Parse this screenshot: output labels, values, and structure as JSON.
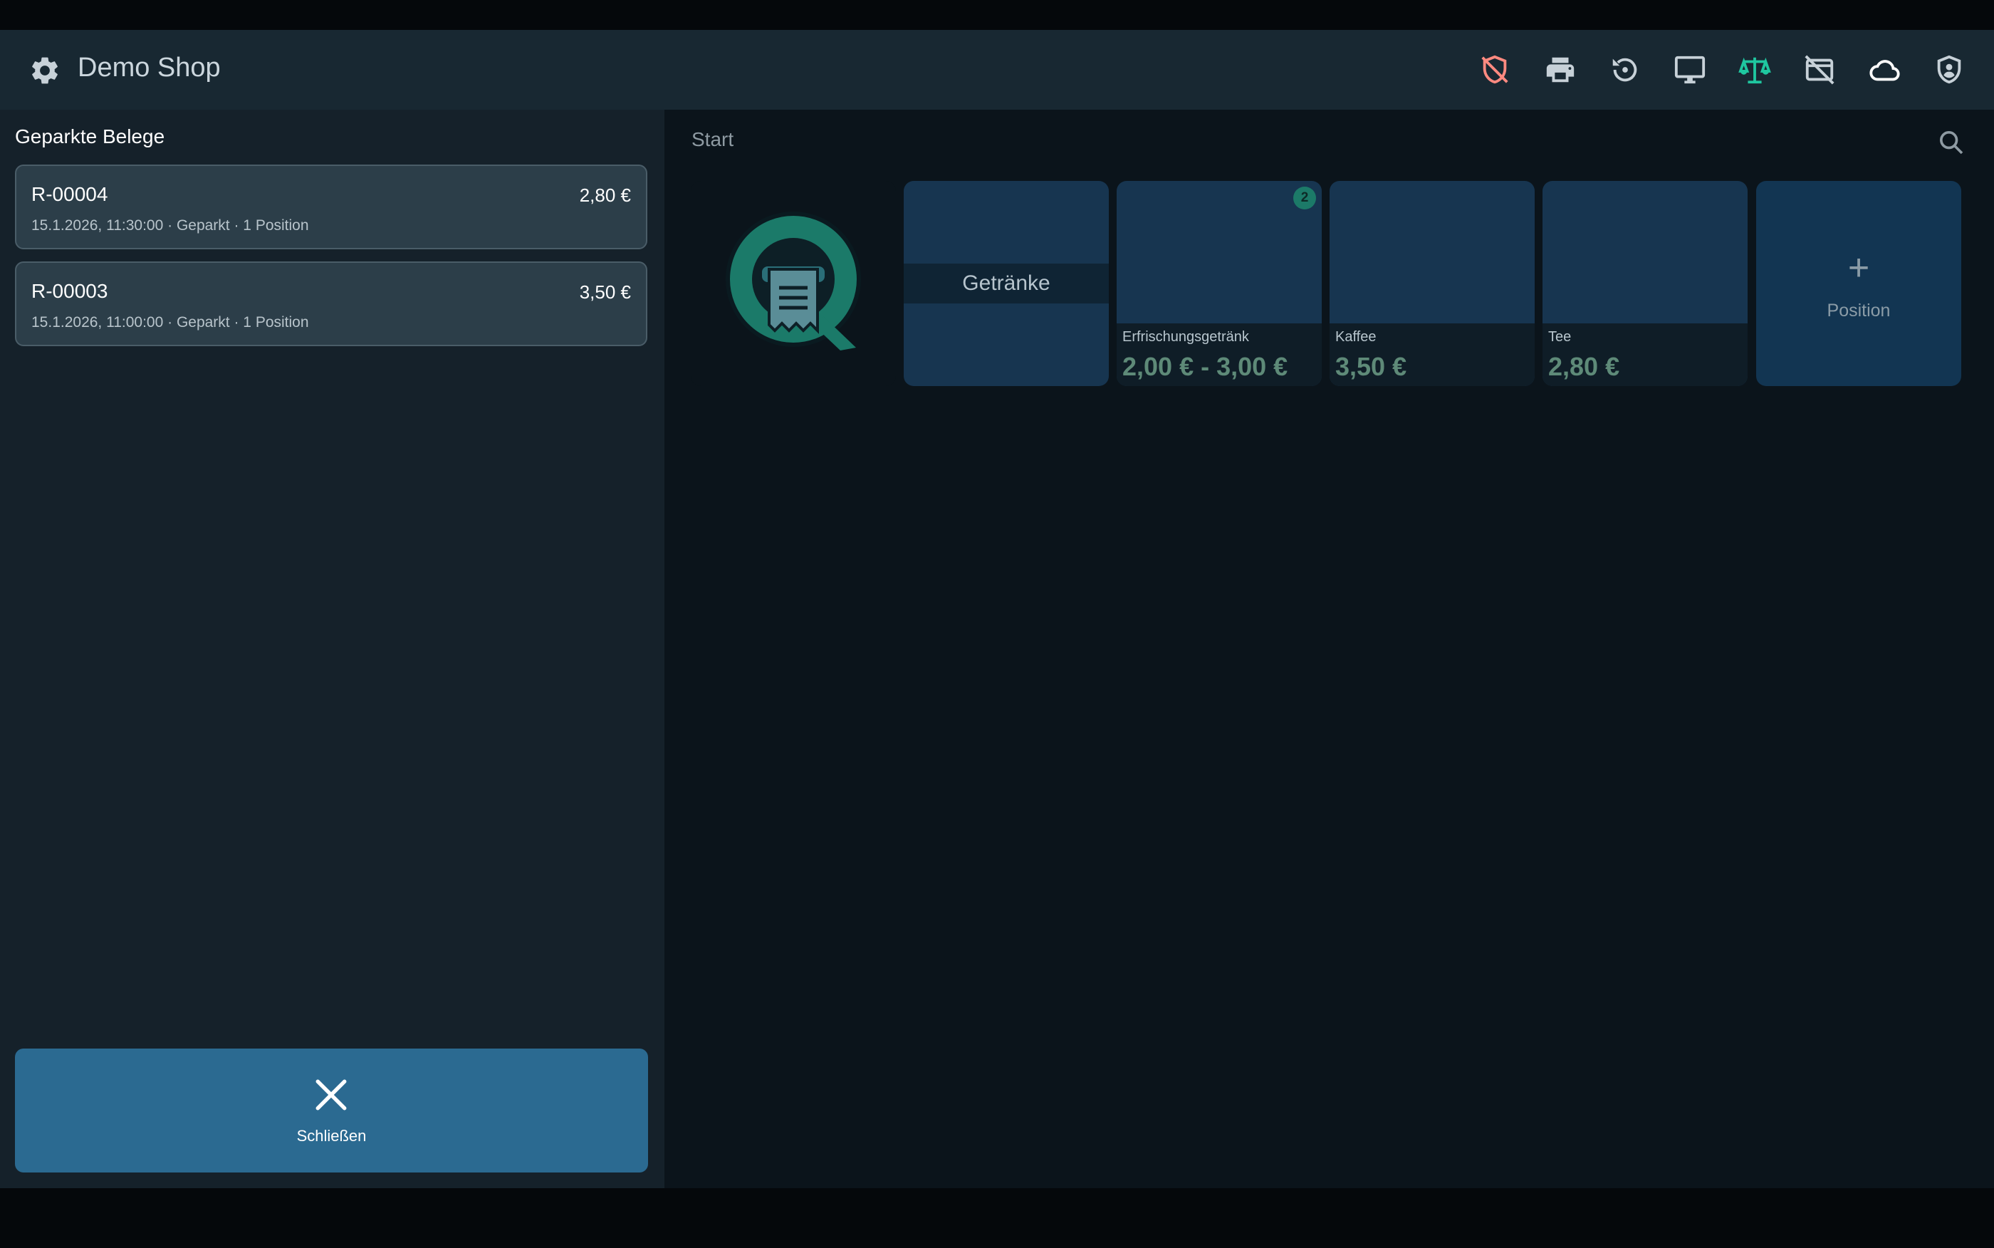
{
  "header": {
    "title": "Demo Shop",
    "icons": [
      "settings-icon",
      "shield-off-icon",
      "printer-icon",
      "history-icon",
      "monitor-icon",
      "scale-icon",
      "card-off-icon",
      "cloud-icon",
      "account-shield-icon"
    ]
  },
  "left": {
    "title": "Geparkte Belege",
    "receipts": [
      {
        "number": "R-00004",
        "amount": "2,80 €",
        "meta": "15.1.2026, 11:30:00 · Geparkt · 1 Position"
      },
      {
        "number": "R-00003",
        "amount": "3,50 €",
        "meta": "15.1.2026, 11:00:00 · Geparkt · 1 Position"
      }
    ],
    "close_label": "Schließen"
  },
  "main": {
    "breadcrumb": "Start",
    "category": {
      "label": "Getränke"
    },
    "products": [
      {
        "name": "Erfrischungsgetränk",
        "price": "2,00 € - 3,00 €",
        "badge": "2"
      },
      {
        "name": "Kaffee",
        "price": "3,50 €"
      },
      {
        "name": "Tee",
        "price": "2,80 €"
      }
    ],
    "add": {
      "label": "Position",
      "symbol": "+"
    }
  },
  "colors": {
    "accent": "#2b6a91",
    "active_icon": "#1fc7a0",
    "warning_icon": "#ff8a80"
  }
}
